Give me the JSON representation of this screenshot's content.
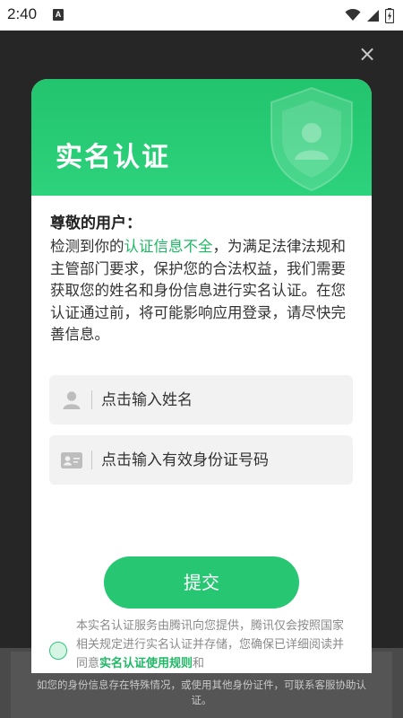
{
  "status_bar": {
    "time": "2:40",
    "notification_badge": "A",
    "icons": [
      "wifi-icon",
      "signal-icon",
      "battery-icon"
    ]
  },
  "dialog": {
    "close_glyph": "×",
    "title": "实名认证",
    "greeting": "尊敬的用户：",
    "notice": {
      "part1": "检测到你的",
      "highlight": "认证信息不全",
      "part2": "，为满足法律法规和主管部门要求，保护您的合法权益，我们需要获取您的姓名和身份信息进行实名认证。在您认证通过前，将可能影响应用登录，请尽快完善信息。"
    },
    "name_field": {
      "placeholder": "点击输入姓名",
      "value": ""
    },
    "id_field": {
      "placeholder": "点击输入有效身份证号码",
      "value": ""
    },
    "submit_label": "提交",
    "agreement": {
      "text_before_link": "本实名认证服务由腾讯向您提供，腾讯仅会按照国家相关规定进行实名认证并存储，您确保已详细阅读并同意",
      "link": "实名认证使用规则",
      "text_after_link": "和"
    }
  },
  "footer_note": "如您的身份信息存在特殊情况，或使用其他身份证件，可联系客服协助认证。",
  "colors": {
    "accent": "#26c673",
    "header_green": "#22c56d",
    "highlight_text": "#1fb865"
  }
}
